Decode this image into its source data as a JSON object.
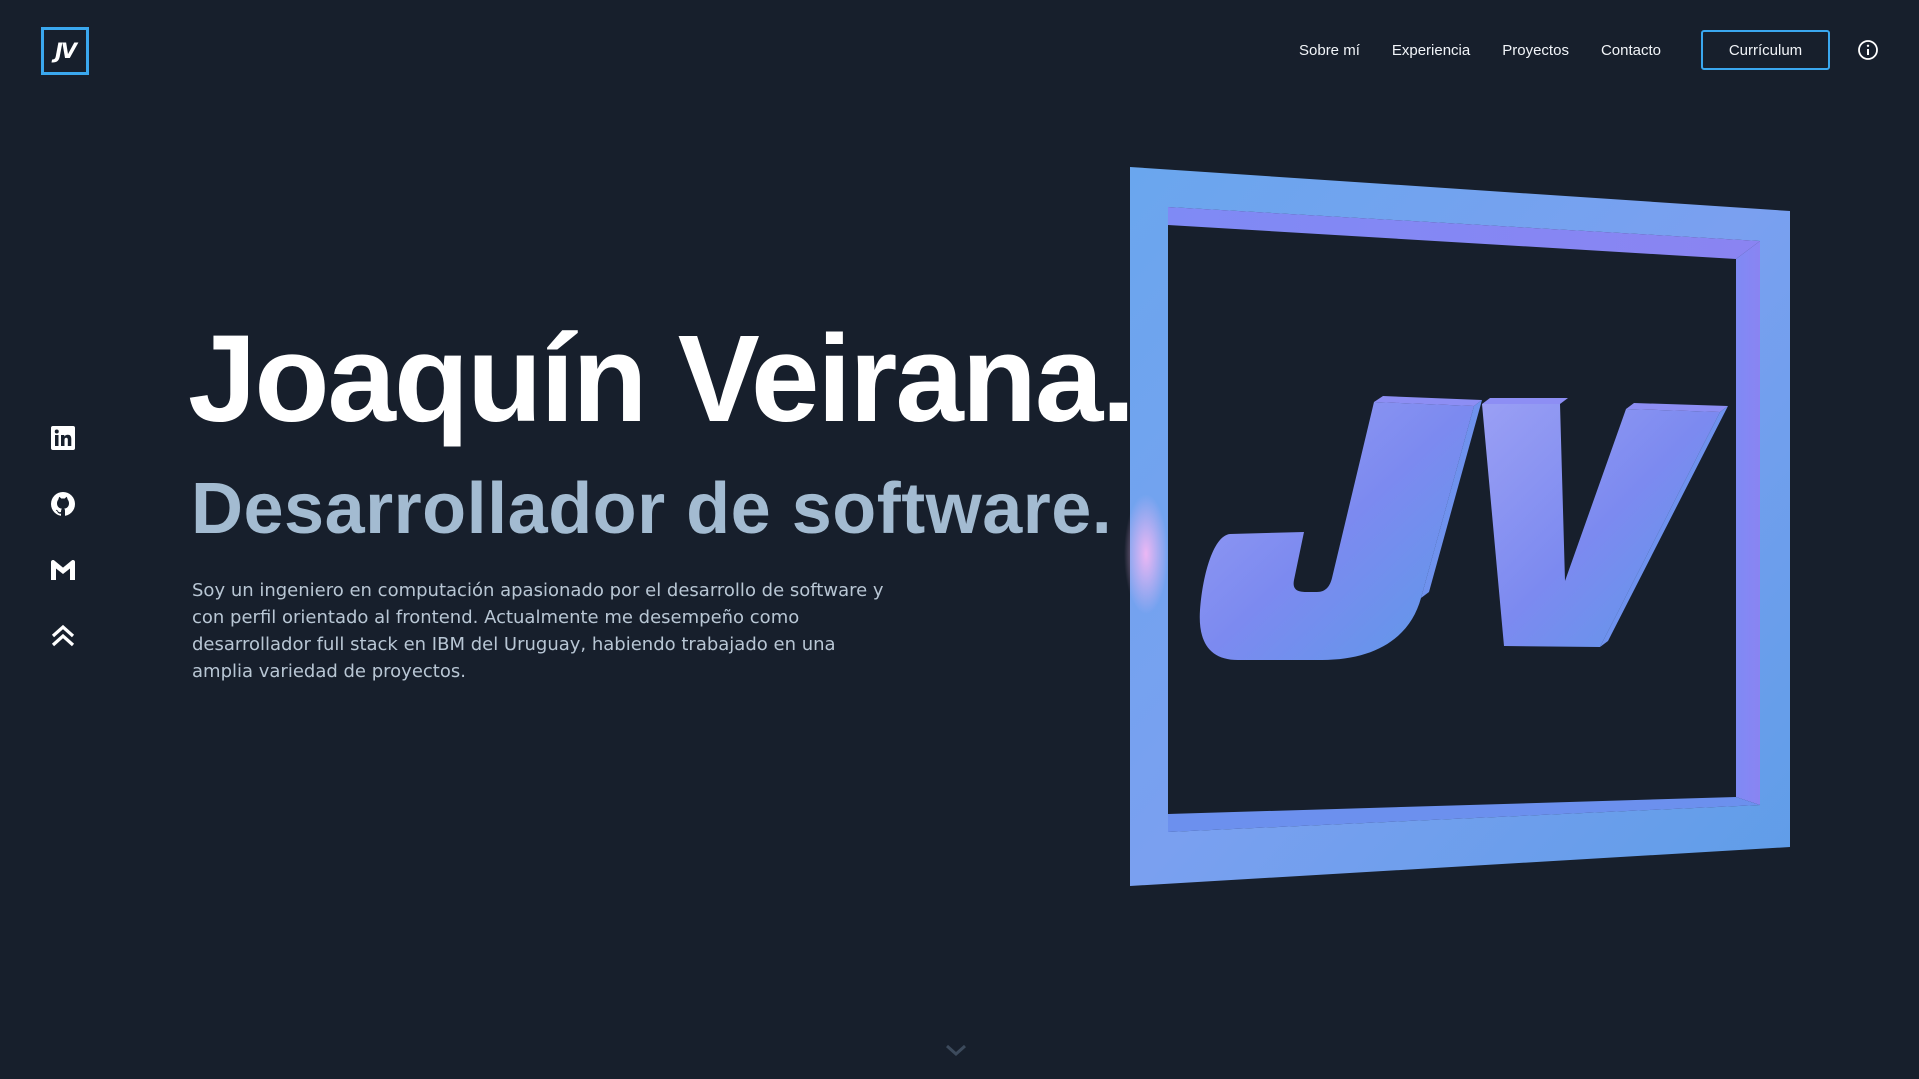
{
  "header": {
    "logo_text": "JV",
    "nav": [
      {
        "label": "Sobre mí"
      },
      {
        "label": "Experiencia"
      },
      {
        "label": "Proyectos"
      },
      {
        "label": "Contacto"
      }
    ],
    "cv_label": "Currículum",
    "info_icon": "info-circle-icon"
  },
  "social": [
    {
      "icon": "linkedin-icon"
    },
    {
      "icon": "github-icon"
    },
    {
      "icon": "gmail-icon"
    },
    {
      "icon": "double-chevron-up-icon"
    }
  ],
  "hero": {
    "name": "Joaquín Veirana.",
    "role": "Desarrollador de software.",
    "description": "Soy un ingeniero en computación apasionado por el desarrollo de software y con perfil orientado al frontend. Actualmente me desempeño como desarrollador full stack en IBM del Uruguay, habiendo trabajado en una amplia variedad de proyectos.",
    "illustration_text": "JV"
  },
  "scroll_icon": "chevron-down-icon",
  "colors": {
    "background": "#171f2c",
    "accent": "#3aa7ee",
    "subtitle": "#a3bbd1",
    "logo_gradient_a": "#6aa6ee",
    "logo_gradient_b": "#8a84f2"
  }
}
